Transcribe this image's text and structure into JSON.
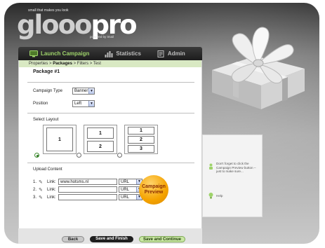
{
  "brand": {
    "tagline": "small that makes you look",
    "logo_part1": "glooo",
    "logo_part2": "pro",
    "powered_by": "powered by tmail"
  },
  "nav": {
    "items": [
      {
        "label": "Launch Campaign",
        "icon": "monitor-icon",
        "active": true
      },
      {
        "label": "Statistics",
        "icon": "bar-chart-icon",
        "active": false
      },
      {
        "label": "Admin",
        "icon": "document-icon",
        "active": false
      }
    ]
  },
  "breadcrumb": {
    "step1": "Properties",
    "sep": ">",
    "step2": "Packages",
    "step3": "Filters",
    "step4": "Test"
  },
  "package": {
    "title": "Package #1"
  },
  "campaign": {
    "type_label": "Campaign Type",
    "type_value": "Banner",
    "position_label": "Position",
    "position_value": "Left"
  },
  "layout": {
    "label": "Select Layout",
    "slot_labels": [
      "1",
      "1",
      "2",
      "1",
      "2",
      "3"
    ]
  },
  "upload": {
    "label": "Upload Content",
    "rows": [
      {
        "num": "1.",
        "link_label": "Link:",
        "value": "www.hotsms.nl",
        "type": "URL"
      },
      {
        "num": "2.",
        "link_label": "Link:",
        "value": "",
        "type": "URL"
      },
      {
        "num": "3.",
        "link_label": "Link:",
        "value": "",
        "type": "URL"
      }
    ],
    "preview_button": "Campaign Preview"
  },
  "actions": {
    "back": "Back",
    "save_finish": "Save and Finish",
    "save_continue": "Save and Continue"
  },
  "side": {
    "hint": "Don't forget to click the Campaign Preview button – just to make sure...",
    "help": "Help"
  },
  "colors": {
    "accent_green": "#9ed36a",
    "breadcrumb_bg": "#d9e9c3",
    "preview_orange": "#f5a300",
    "check_orange": "#f0a300"
  }
}
